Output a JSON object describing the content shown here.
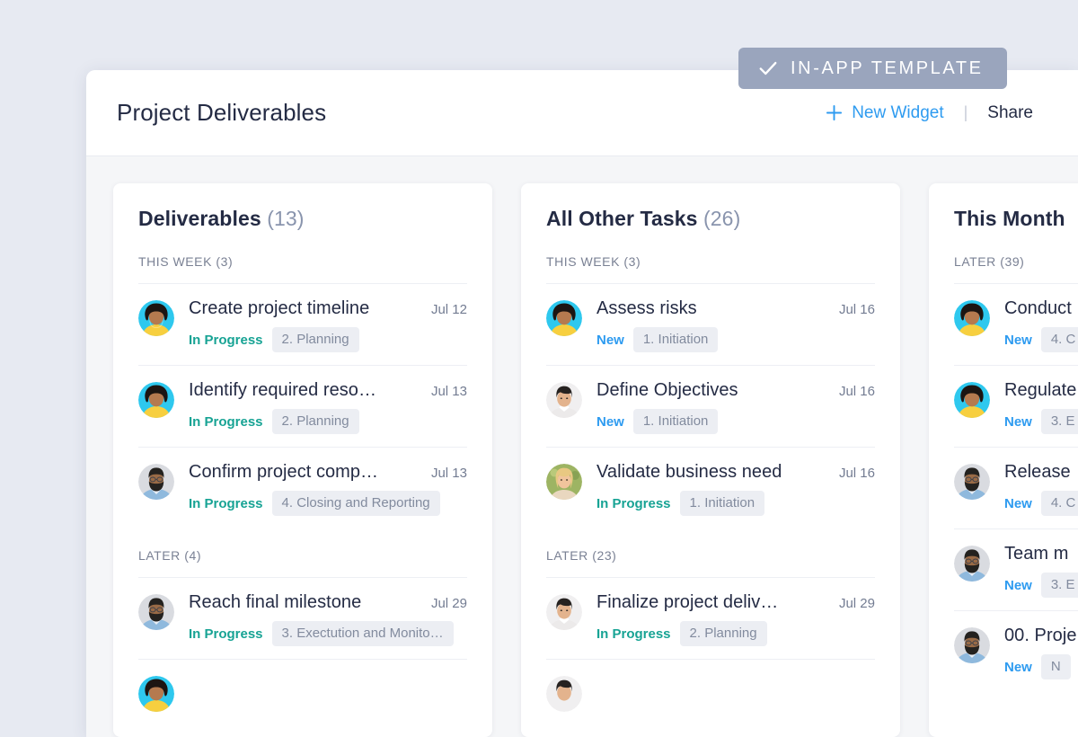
{
  "badge": {
    "label": "IN-APP TEMPLATE",
    "icon": "check-icon",
    "bg": "#9aa5bd"
  },
  "header": {
    "title": "Project Deliverables",
    "new_widget_label": "New Widget",
    "new_widget_icon": "plus-icon",
    "separator": "|",
    "share_label": "Share",
    "accent": "#2e9bf0"
  },
  "colors": {
    "page_bg": "#e7eaf2",
    "board_bg": "#f5f6f8",
    "card_bg": "#ffffff",
    "title": "#242b44",
    "status_in_progress": "#17a394",
    "status_new": "#2e9bf0",
    "tag_bg": "#eceef3",
    "tag_text": "#828b9e"
  },
  "columns": [
    {
      "title": "Deliverables",
      "count": "(13)",
      "groups": [
        {
          "label": "THIS WEEK (3)",
          "tasks": [
            {
              "avatar": "woman-curly-hair",
              "name": "Create project timeline",
              "date": "Jul 12",
              "status": "In Progress",
              "status_kind": "inprogress",
              "tag": "2. Planning"
            },
            {
              "avatar": "woman-curly-hair",
              "name": "Identify required reso…",
              "date": "Jul 13",
              "status": "In Progress",
              "status_kind": "inprogress",
              "tag": "2. Planning"
            },
            {
              "avatar": "man-beard-glasses",
              "name": "Confirm project comp…",
              "date": "Jul 13",
              "status": "In Progress",
              "status_kind": "inprogress",
              "tag": "4. Closing and Reporting"
            }
          ]
        },
        {
          "label": "LATER (4)",
          "tasks": [
            {
              "avatar": "man-beard-glasses",
              "name": "Reach final milestone",
              "date": "Jul 29",
              "status": "In Progress",
              "status_kind": "inprogress",
              "tag": "3. Exectution and Monito…"
            },
            {
              "avatar": "woman-curly-hair",
              "name": "",
              "date": "",
              "status": "",
              "status_kind": "inprogress",
              "tag": ""
            }
          ]
        }
      ]
    },
    {
      "title": "All Other Tasks",
      "count": "(26)",
      "groups": [
        {
          "label": "THIS WEEK (3)",
          "tasks": [
            {
              "avatar": "woman-curly-hair",
              "name": "Assess risks",
              "date": "Jul 16",
              "status": "New",
              "status_kind": "new",
              "tag": "1. Initiation"
            },
            {
              "avatar": "man-asian",
              "name": "Define Objectives",
              "date": "Jul 16",
              "status": "New",
              "status_kind": "new",
              "tag": "1. Initiation"
            },
            {
              "avatar": "woman-blonde",
              "name": "Validate business need",
              "date": "Jul 16",
              "status": "In Progress",
              "status_kind": "inprogress",
              "tag": "1. Initiation"
            }
          ]
        },
        {
          "label": "LATER (23)",
          "tasks": [
            {
              "avatar": "man-asian",
              "name": "Finalize project deliv…",
              "date": "Jul 29",
              "status": "In Progress",
              "status_kind": "inprogress",
              "tag": "2. Planning"
            },
            {
              "avatar": "man-asian",
              "name": "",
              "date": "",
              "status": "",
              "status_kind": "new",
              "tag": ""
            }
          ]
        }
      ]
    },
    {
      "title": "This Month",
      "count": "",
      "groups": [
        {
          "label": "LATER (39)",
          "tasks": [
            {
              "avatar": "woman-curly-hair",
              "name": "Conduct",
              "date": "",
              "status": "New",
              "status_kind": "new",
              "tag": "4. C"
            },
            {
              "avatar": "woman-curly-hair",
              "name": "Regulate",
              "date": "",
              "status": "New",
              "status_kind": "new",
              "tag": "3. E"
            },
            {
              "avatar": "man-beard-glasses",
              "name": "Release",
              "date": "",
              "status": "New",
              "status_kind": "new",
              "tag": "4. C"
            },
            {
              "avatar": "man-beard-glasses",
              "name": "Team m",
              "date": "",
              "status": "New",
              "status_kind": "new",
              "tag": "3. E"
            },
            {
              "avatar": "man-beard-glasses",
              "name": "00. Proje",
              "date": "",
              "status": "New",
              "status_kind": "new",
              "tag": "N"
            }
          ]
        }
      ]
    }
  ]
}
